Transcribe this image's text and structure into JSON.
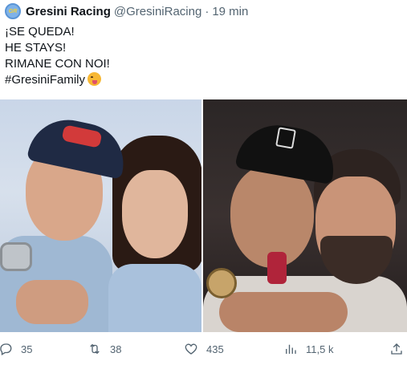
{
  "header": {
    "display_name": "Gresini Racing",
    "handle": "@GresiniRacing",
    "separator": "·",
    "time": "19 min",
    "avatar_text": "GR"
  },
  "tweet": {
    "lines": [
      "¡SE QUEDA!",
      "HE STAYS!",
      "RIMANE CON NOI!",
      "#GresiniFamily"
    ],
    "emoji": "face-with-tongue"
  },
  "media": {
    "count": 2
  },
  "actions": {
    "replies": "35",
    "retweets": "38",
    "likes": "435",
    "views": "11,5 k"
  }
}
